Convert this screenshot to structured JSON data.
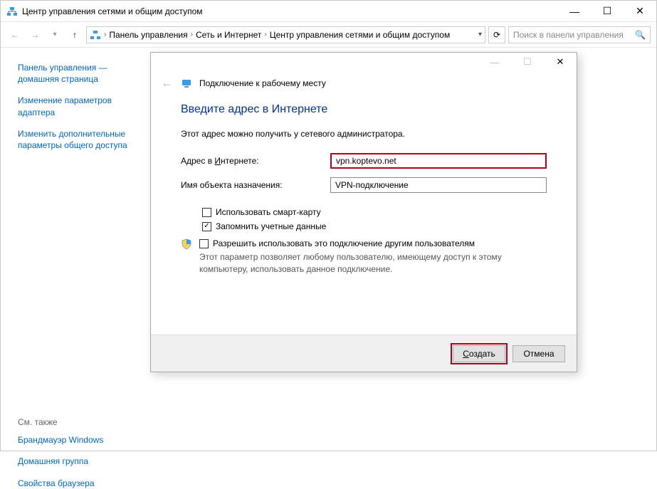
{
  "window": {
    "title": "Центр управления сетями и общим доступом"
  },
  "breadcrumb": {
    "items": [
      "Панель управления",
      "Сеть и Интернет",
      "Центр управления сетями и общим доступом"
    ]
  },
  "search": {
    "placeholder": "Поиск в панели управления"
  },
  "sidebar": {
    "home": "Панель управления — домашняя страница",
    "links": [
      "Изменение параметров адаптера",
      "Изменить дополнительные параметры общего доступа"
    ],
    "see_also_label": "См. также",
    "see_also": [
      "Брандмауэр Windows",
      "Домашняя группа",
      "Свойства браузера"
    ]
  },
  "dialog": {
    "header_title": "Подключение к рабочему месту",
    "heading": "Введите адрес в Интернете",
    "description": "Этот адрес можно получить у сетевого администратора.",
    "addr_label_pre": "Адрес в ",
    "addr_label_ul": "И",
    "addr_label_post": "нтернете:",
    "addr_value": "vpn.koptevo.net",
    "name_label": "Имя объекта назначения:",
    "name_value": "VPN-подключение",
    "smartcard_pre": "Использовать с",
    "smartcard_ul": "м",
    "smartcard_post": "арт-карту",
    "remember_ul": "З",
    "remember_post": "апомнить учетные данные",
    "allow_ul": "Р",
    "allow_post": "азрешить использовать это подключение другим пользователям",
    "allow_desc": "Этот параметр позволяет любому пользователю, имеющему доступ к этому компьютеру, использовать данное подключение.",
    "create_ul": "С",
    "create_post": "оздать",
    "cancel": "Отмена"
  }
}
